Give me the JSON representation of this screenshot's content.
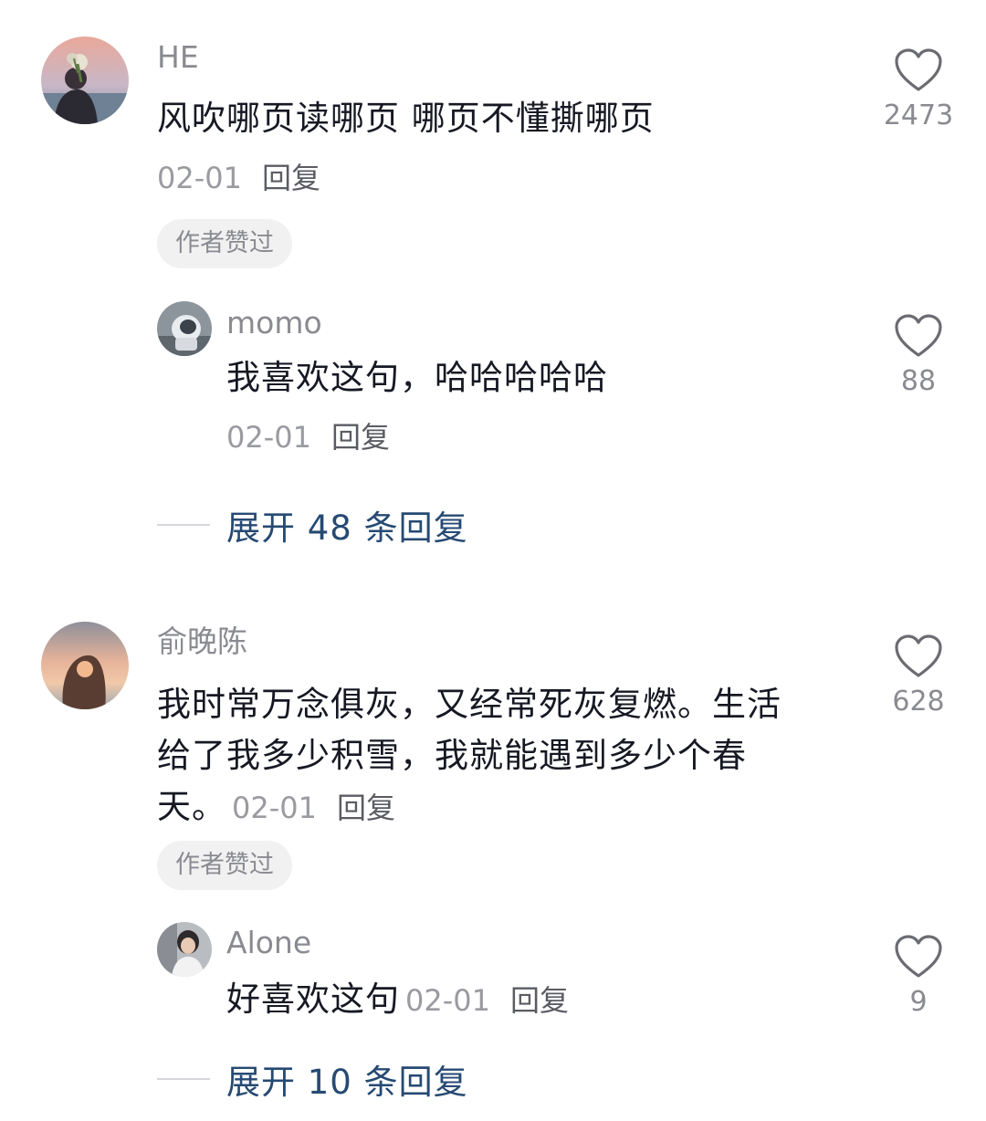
{
  "comments": [
    {
      "username": "HE",
      "text": "风吹哪页读哪页 哪页不懂撕哪页",
      "date": "02-01",
      "reply_label": "回复",
      "badge": "作者赞过",
      "likes": "2473",
      "avatar_icon": "avatar-photo-sunset-flowers",
      "replies": [
        {
          "username": "momo",
          "text": "我喜欢这句，哈哈哈哈哈",
          "date": "02-01",
          "reply_label": "回复",
          "likes": "88",
          "avatar_icon": "avatar-photo-astronaut"
        }
      ],
      "expand_label": "展开 48 条回复"
    },
    {
      "username": "俞晚陈",
      "text": "我时常万念俱灰，又经常死灰复燃。生活给了我多少积雪，我就能遇到多少个春天。",
      "date": "02-01",
      "reply_label": "回复",
      "badge": "作者赞过",
      "likes": "628",
      "avatar_icon": "avatar-photo-hand-sunset",
      "replies": [
        {
          "username": "Alone",
          "text": "好喜欢这句",
          "date": "02-01",
          "reply_label": "回复",
          "likes": "9",
          "avatar_icon": "avatar-photo-girl"
        }
      ],
      "expand_label": "展开 10 条回复"
    }
  ],
  "icons": {
    "like": "heart-outline-icon"
  },
  "colors": {
    "text": "#161823",
    "secondary": "#8a8b91",
    "link": "#264a73",
    "badge_bg": "#f1f1f2"
  }
}
